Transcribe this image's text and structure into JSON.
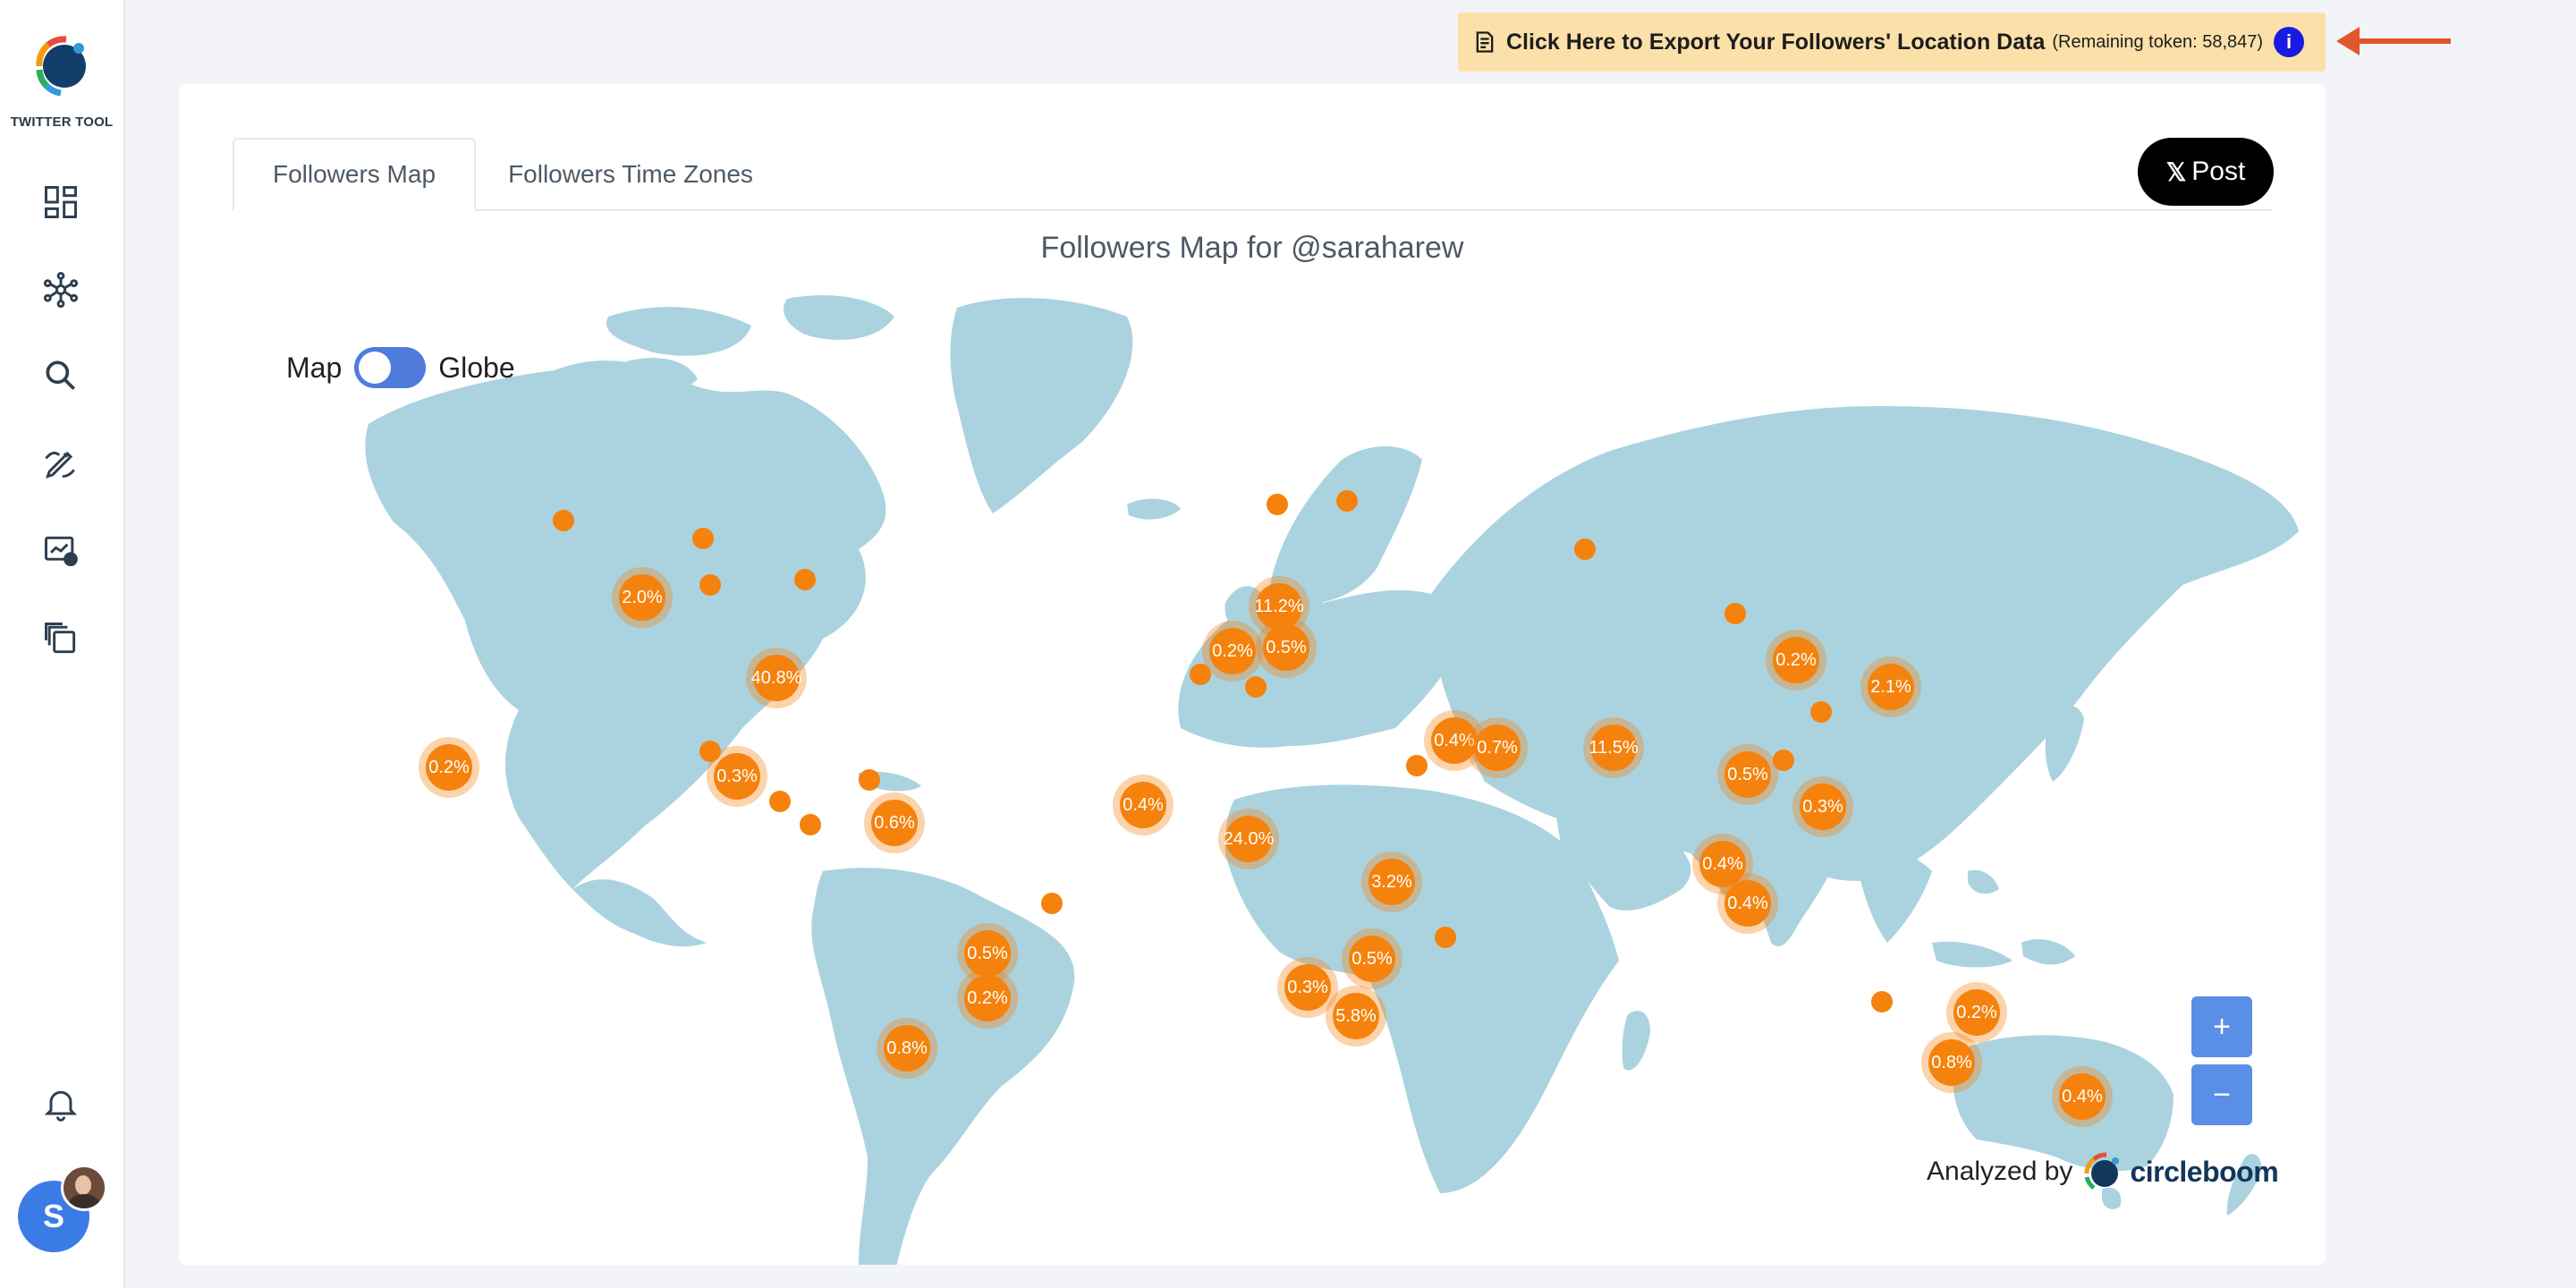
{
  "sidebar": {
    "logo_text": "TWITTER TOOL",
    "items": [
      {
        "icon": "dashboard-icon"
      },
      {
        "icon": "network-icon"
      },
      {
        "icon": "search-icon"
      },
      {
        "icon": "compose-icon"
      },
      {
        "icon": "analytics-icon"
      },
      {
        "icon": "copy-icon"
      }
    ],
    "notification_icon": "bell-icon",
    "avatar_letter": "S"
  },
  "export": {
    "title": "Click Here to Export Your Followers' Location Data",
    "remaining": "(Remaining token: 58,847)",
    "info": "i"
  },
  "tabs": [
    {
      "label": "Followers Map",
      "active": true
    },
    {
      "label": "Followers Time Zones",
      "active": false
    }
  ],
  "post_button": {
    "x": "𝕏",
    "label": "Post"
  },
  "map": {
    "title": "Followers Map for @saraharew",
    "toggle": {
      "left": "Map",
      "right": "Globe"
    },
    "zoom_in": "+",
    "zoom_out": "−",
    "analyzed_by": "Analyzed by",
    "brand": "circleboom",
    "markers": [
      {
        "label": "2.0%",
        "region": "US West"
      },
      {
        "label": "40.8%",
        "region": "US East"
      },
      {
        "label": "0.2%",
        "region": "Hawaii"
      },
      {
        "label": "0.3%",
        "region": "Mexico"
      },
      {
        "label": "0.6%",
        "region": "Colombia"
      },
      {
        "label": "0.5%",
        "region": "Brazil"
      },
      {
        "label": "0.2%",
        "region": "Brazil South"
      },
      {
        "label": "0.8%",
        "region": "Argentina"
      },
      {
        "label": "11.2%",
        "region": "Western Europe"
      },
      {
        "label": "0.2%",
        "region": "Spain"
      },
      {
        "label": "0.5%",
        "region": "Italy"
      },
      {
        "label": "0.4%",
        "region": "West Africa"
      },
      {
        "label": "24.0%",
        "region": "Nigeria"
      },
      {
        "label": "3.2%",
        "region": "East Africa"
      },
      {
        "label": "0.5%",
        "region": "Southern Africa"
      },
      {
        "label": "0.3%",
        "region": "Namibia"
      },
      {
        "label": "5.8%",
        "region": "South Africa"
      },
      {
        "label": "0.4%",
        "region": "Saudi Arabia"
      },
      {
        "label": "0.7%",
        "region": "UAE"
      },
      {
        "label": "11.5%",
        "region": "India"
      },
      {
        "label": "0.5%",
        "region": "Southeast Asia"
      },
      {
        "label": "0.4%",
        "region": "Malaysia"
      },
      {
        "label": "0.4%",
        "region": "Indonesia"
      },
      {
        "label": "0.3%",
        "region": "Philippines"
      },
      {
        "label": "0.2%",
        "region": "Korea"
      },
      {
        "label": "2.1%",
        "region": "Japan"
      },
      {
        "label": "0.2%",
        "region": "Australia East"
      },
      {
        "label": "0.8%",
        "region": "Australia South"
      },
      {
        "label": "0.4%",
        "region": "New Zealand"
      }
    ]
  },
  "colors": {
    "accent": "#f5820d",
    "land": "#aad3df",
    "toggle": "#4f7bdb",
    "banner": "#fbe1a9"
  }
}
